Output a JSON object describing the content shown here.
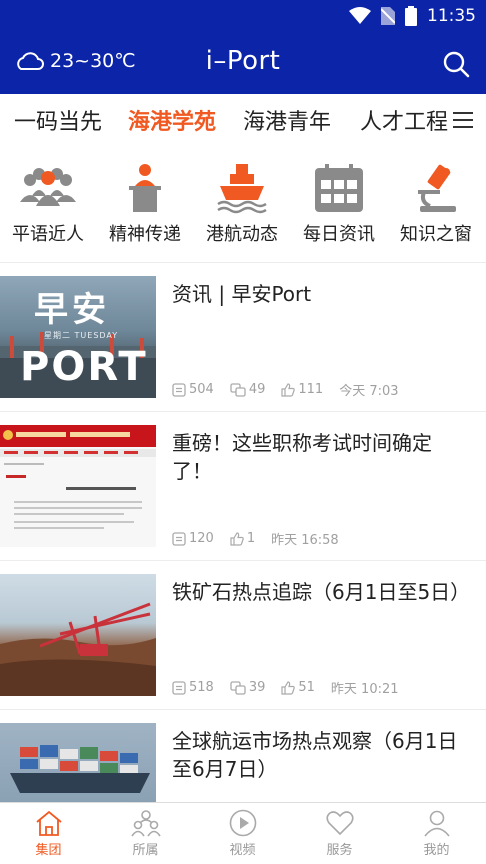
{
  "status": {
    "time": "11:35"
  },
  "header": {
    "temperature": "23~30℃",
    "title": "i–Port"
  },
  "tabs": [
    {
      "label": "一码当先",
      "active": false
    },
    {
      "label": "海港学苑",
      "active": true
    },
    {
      "label": "海港青年",
      "active": false
    },
    {
      "label": "人才工程",
      "active": false
    }
  ],
  "shortcuts": [
    {
      "label": "平语近人",
      "icon": "group-people-icon"
    },
    {
      "label": "精神传递",
      "icon": "speaker-podium-icon"
    },
    {
      "label": "港航动态",
      "icon": "ship-icon"
    },
    {
      "label": "每日资讯",
      "icon": "calendar-icon"
    },
    {
      "label": "知识之窗",
      "icon": "microscope-icon"
    }
  ],
  "articles": [
    {
      "title": "资讯 | 早安Port",
      "comments": "504",
      "shares": "49",
      "likes": "111",
      "time": "今天 7:03",
      "thumb": {
        "big": "早安",
        "small": "星期二 TUESDAY",
        "word": "PORT"
      }
    },
    {
      "title": "重磅！这些职称考试时间确定了！",
      "comments": "120",
      "likes": "1",
      "time": "昨天 16:58"
    },
    {
      "title": "铁矿石热点追踪（6月1日至5日）",
      "comments": "518",
      "shares": "39",
      "likes": "51",
      "time": "昨天 10:21"
    },
    {
      "title": "全球航运市场热点观察（6月1日至6月7日）"
    }
  ],
  "bottom_nav": [
    {
      "label": "集团",
      "active": true
    },
    {
      "label": "所属",
      "active": false
    },
    {
      "label": "视频",
      "active": false
    },
    {
      "label": "服务",
      "active": false
    },
    {
      "label": "我的",
      "active": false
    }
  ],
  "colors": {
    "header_bg": "#0b24a8",
    "accent": "#f05a22",
    "icon_gray": "#8a8a8a"
  }
}
